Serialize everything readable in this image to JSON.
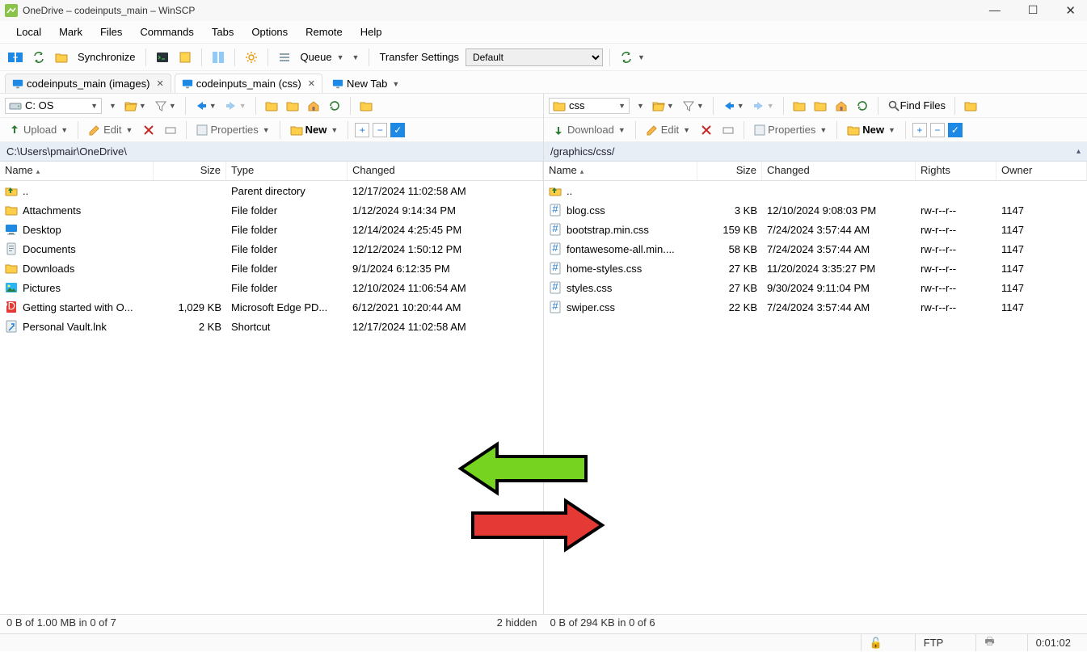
{
  "window": {
    "title": "OneDrive – codeinputs_main – WinSCP"
  },
  "menu": [
    "Local",
    "Mark",
    "Files",
    "Commands",
    "Tabs",
    "Options",
    "Remote",
    "Help"
  ],
  "toolbar": {
    "sync": "Synchronize",
    "queue": "Queue",
    "transfer_label": "Transfer Settings",
    "transfer_value": "Default"
  },
  "tabs": [
    {
      "label": "codeinputs_main (images)",
      "active": false,
      "closable": true
    },
    {
      "label": "codeinputs_main (css)",
      "active": true,
      "closable": true
    }
  ],
  "newtab_label": "New Tab",
  "left": {
    "drive_label": "C: OS",
    "upload": "Upload",
    "edit": "Edit",
    "props": "Properties",
    "new": "New",
    "path": "C:\\Users\\pmair\\OneDrive\\",
    "cols": {
      "name": "Name",
      "size": "Size",
      "type": "Type",
      "changed": "Changed"
    },
    "rows": [
      {
        "icon": "up",
        "name": "..",
        "size": "",
        "type": "Parent directory",
        "changed": "12/17/2024 11:02:58 AM"
      },
      {
        "icon": "folder",
        "name": "Attachments",
        "size": "",
        "type": "File folder",
        "changed": "1/12/2024 9:14:34 PM"
      },
      {
        "icon": "desktop",
        "name": "Desktop",
        "size": "",
        "type": "File folder",
        "changed": "12/14/2024 4:25:45 PM"
      },
      {
        "icon": "docs",
        "name": "Documents",
        "size": "",
        "type": "File folder",
        "changed": "12/12/2024 1:50:12 PM"
      },
      {
        "icon": "folder",
        "name": "Downloads",
        "size": "",
        "type": "File folder",
        "changed": "9/1/2024 6:12:35 PM"
      },
      {
        "icon": "pics",
        "name": "Pictures",
        "size": "",
        "type": "File folder",
        "changed": "12/10/2024 11:06:54 AM"
      },
      {
        "icon": "pdf",
        "name": "Getting started with O...",
        "size": "1,029 KB",
        "type": "Microsoft Edge PD...",
        "changed": "6/12/2021 10:20:44 AM"
      },
      {
        "icon": "link",
        "name": "Personal Vault.lnk",
        "size": "2 KB",
        "type": "Shortcut",
        "changed": "12/17/2024 11:02:58 AM"
      }
    ],
    "summary_left": "0 B of 1.00 MB in 0 of 7",
    "summary_right": "2 hidden"
  },
  "right": {
    "dir_label": "css",
    "download": "Download",
    "edit": "Edit",
    "props": "Properties",
    "new": "New",
    "find": "Find Files",
    "path": "/graphics/css/",
    "cols": {
      "name": "Name",
      "size": "Size",
      "changed": "Changed",
      "rights": "Rights",
      "owner": "Owner"
    },
    "rows": [
      {
        "icon": "up",
        "name": "..",
        "size": "",
        "changed": "",
        "rights": "",
        "owner": ""
      },
      {
        "icon": "css",
        "name": "blog.css",
        "size": "3 KB",
        "changed": "12/10/2024 9:08:03 PM",
        "rights": "rw-r--r--",
        "owner": "1147"
      },
      {
        "icon": "css",
        "name": "bootstrap.min.css",
        "size": "159 KB",
        "changed": "7/24/2024 3:57:44 AM",
        "rights": "rw-r--r--",
        "owner": "1147"
      },
      {
        "icon": "css",
        "name": "fontawesome-all.min....",
        "size": "58 KB",
        "changed": "7/24/2024 3:57:44 AM",
        "rights": "rw-r--r--",
        "owner": "1147"
      },
      {
        "icon": "css",
        "name": "home-styles.css",
        "size": "27 KB",
        "changed": "11/20/2024 3:35:27 PM",
        "rights": "rw-r--r--",
        "owner": "1147"
      },
      {
        "icon": "css",
        "name": "styles.css",
        "size": "27 KB",
        "changed": "9/30/2024 9:11:04 PM",
        "rights": "rw-r--r--",
        "owner": "1147"
      },
      {
        "icon": "css",
        "name": "swiper.css",
        "size": "22 KB",
        "changed": "7/24/2024 3:57:44 AM",
        "rights": "rw-r--r--",
        "owner": "1147"
      }
    ],
    "summary": "0 B of 294 KB in 0 of 6"
  },
  "status": {
    "protocol": "FTP",
    "time": "0:01:02"
  }
}
